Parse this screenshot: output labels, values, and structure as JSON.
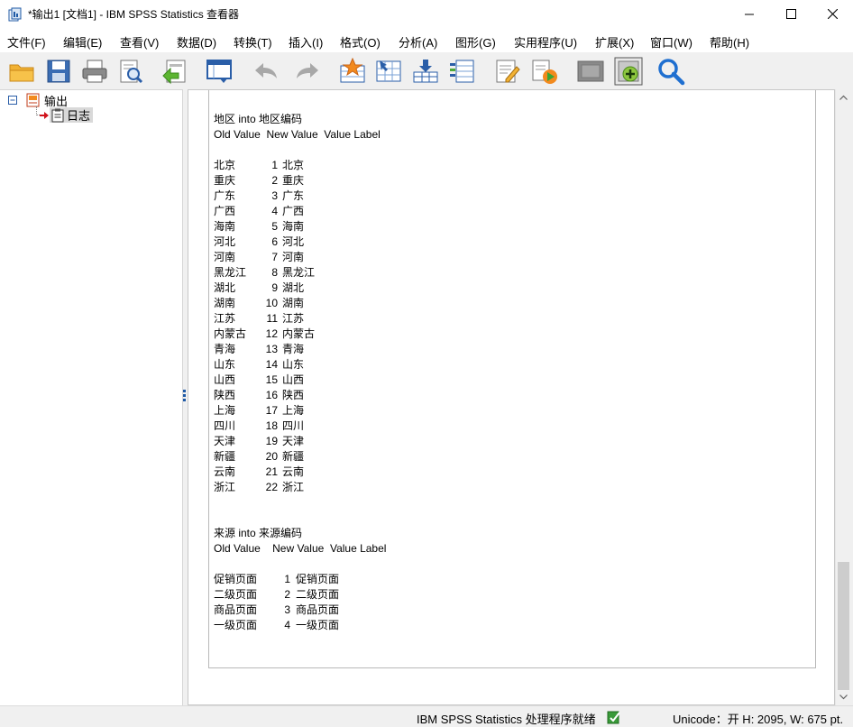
{
  "window": {
    "title": "*输出1 [文档1] - IBM SPSS Statistics 查看器",
    "controls": [
      "minimize",
      "maximize",
      "close"
    ]
  },
  "menu": [
    "文件(F)",
    "编辑(E)",
    "查看(V)",
    "数据(D)",
    "转换(T)",
    "插入(I)",
    "格式(O)",
    "分析(A)",
    "图形(G)",
    "实用程序(U)",
    "扩展(X)",
    "窗口(W)",
    "帮助(H)"
  ],
  "toolbar": {
    "icons": [
      "open-folder-icon",
      "save-icon",
      "print-icon",
      "print-preview-icon",
      "export-icon",
      "goto-data-icon",
      "undo-icon",
      "redo-icon",
      "goto-case-icon",
      "goto-variable-icon",
      "insert-cases-icon",
      "variables-icon",
      "syntax-icon",
      "run-syntax-icon",
      "designate-window-icon",
      "add-item-icon",
      "find-icon"
    ]
  },
  "tree": {
    "root_label": "输出",
    "child_label": "日志"
  },
  "log": {
    "block1": {
      "heading": "地区 into 地区编码",
      "columns": "Old Value  New Value  Value Label",
      "rows": [
        {
          "old": "北京",
          "new": "1",
          "label": "北京"
        },
        {
          "old": "重庆",
          "new": "2",
          "label": "重庆"
        },
        {
          "old": "广东",
          "new": "3",
          "label": "广东"
        },
        {
          "old": "广西",
          "new": "4",
          "label": "广西"
        },
        {
          "old": "海南",
          "new": "5",
          "label": "海南"
        },
        {
          "old": "河北",
          "new": "6",
          "label": "河北"
        },
        {
          "old": "河南",
          "new": "7",
          "label": "河南"
        },
        {
          "old": "黑龙江",
          "new": "8",
          "label": "黑龙江"
        },
        {
          "old": "湖北",
          "new": "9",
          "label": "湖北"
        },
        {
          "old": "湖南",
          "new": "10",
          "label": "湖南"
        },
        {
          "old": "江苏",
          "new": "11",
          "label": "江苏"
        },
        {
          "old": "内蒙古",
          "new": "12",
          "label": "内蒙古"
        },
        {
          "old": "青海",
          "new": "13",
          "label": "青海"
        },
        {
          "old": "山东",
          "new": "14",
          "label": "山东"
        },
        {
          "old": "山西",
          "new": "15",
          "label": "山西"
        },
        {
          "old": "陕西",
          "new": "16",
          "label": "陕西"
        },
        {
          "old": "上海",
          "new": "17",
          "label": "上海"
        },
        {
          "old": "四川",
          "new": "18",
          "label": "四川"
        },
        {
          "old": "天津",
          "new": "19",
          "label": "天津"
        },
        {
          "old": "新疆",
          "new": "20",
          "label": "新疆"
        },
        {
          "old": "云南",
          "new": "21",
          "label": "云南"
        },
        {
          "old": "浙江",
          "new": "22",
          "label": "浙江"
        }
      ]
    },
    "block2": {
      "heading": "来源 into 来源编码",
      "columns": "Old Value    New Value  Value Label",
      "rows": [
        {
          "old": "促销页面",
          "new": "1",
          "label": "促销页面"
        },
        {
          "old": "二级页面",
          "new": "2",
          "label": "二级页面"
        },
        {
          "old": "商品页面",
          "new": "3",
          "label": "商品页面"
        },
        {
          "old": "一级页面",
          "new": "4",
          "label": "一级页面"
        }
      ]
    }
  },
  "status": {
    "processor": "IBM SPSS Statistics 处理程序就绪",
    "unicode": "Unicode：开  H: 2095, W: 675 pt."
  },
  "colors": {
    "accent_blue": "#1f5aa6",
    "toolbar_bg": "#f0f0f0",
    "orange": "#f28a1e"
  }
}
